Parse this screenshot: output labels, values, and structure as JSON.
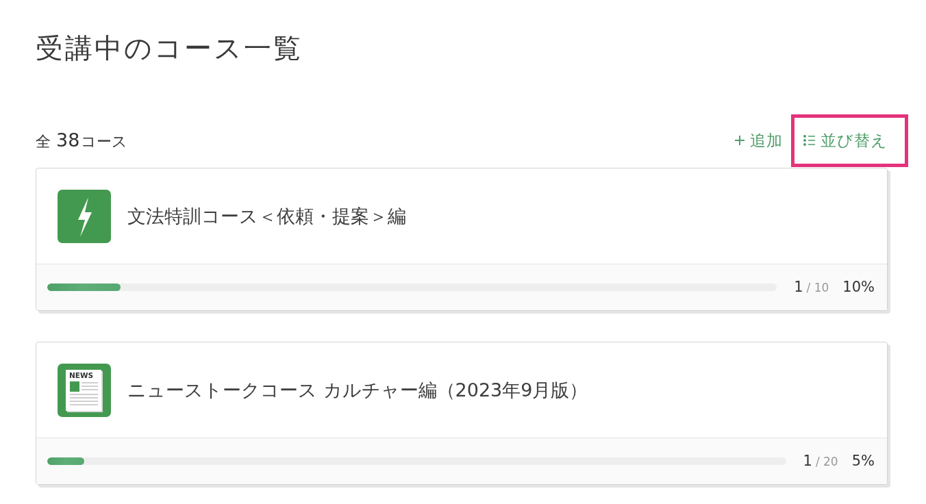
{
  "page": {
    "title": "受講中のコース一覧"
  },
  "summary": {
    "prefix": "全",
    "count": "38",
    "unit": "コース"
  },
  "actions": [
    {
      "kind": "add",
      "label": "追加",
      "highlighted": false
    },
    {
      "kind": "sort",
      "label": "並び替え",
      "highlighted": true
    }
  ],
  "courses": [
    {
      "kind": "bolt",
      "title": "文法特訓コース＜依頼・提案＞編",
      "level": 0.1,
      "done": "1",
      "total": "/ 10",
      "percent": "10%"
    },
    {
      "kind": "news",
      "icon_label": "NEWS",
      "title": "ニューストークコース カルチャー編（2023年9月版）",
      "level": 0.05,
      "done": "1",
      "total": "/ 20",
      "percent": "5%"
    }
  ]
}
